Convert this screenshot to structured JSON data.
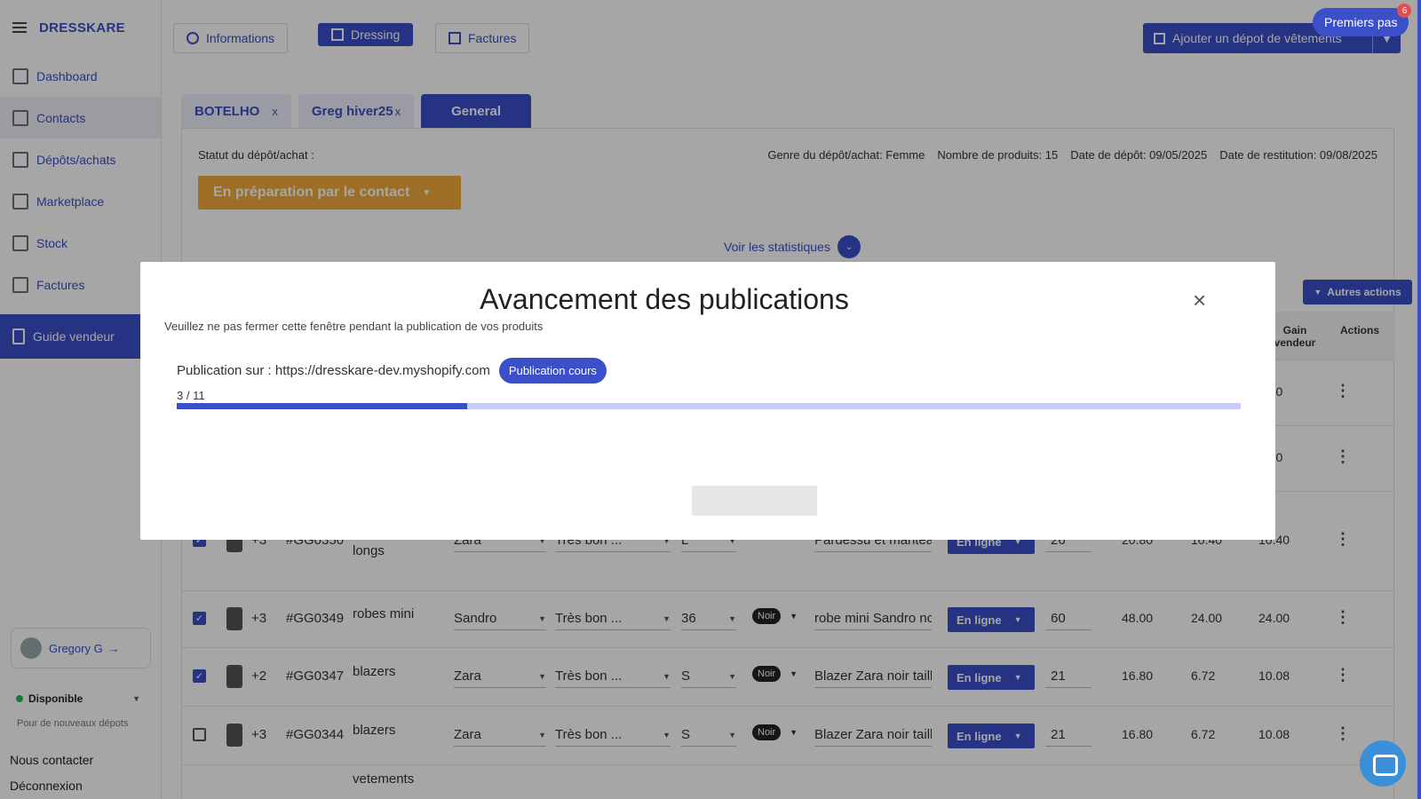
{
  "brand": "DRESSKARE",
  "nav": [
    "Dashboard",
    "Contacts",
    "Dépôts/achats",
    "Marketplace",
    "Stock",
    "Factures"
  ],
  "guide": "Guide vendeur",
  "user": "Gregory G",
  "dispo": "Disponible",
  "dispo_sub": "Pour de nouveaux dépots",
  "contact": "Nous contacter",
  "logout": "Déconnexion",
  "topbar": {
    "informations": "Informations",
    "dressing": "Dressing",
    "factures": "Factures",
    "add": "Ajouter un dépot de vêtements",
    "premiers": "Premiers pas",
    "badge": "6"
  },
  "tabs": [
    "BOTELHO",
    "Greg hiver25",
    "General"
  ],
  "tab_close": "x",
  "statut_label": "Statut du dépôt/achat :",
  "meta": {
    "genre": "Genre du dépôt/achat: Femme",
    "nb": "Nombre de produits: 15",
    "depot": "Date de dépôt: 09/05/2025",
    "restit": "Date de restitution: 09/08/2025"
  },
  "status_value": "En préparation par le contact",
  "voir": "Voir les statistiques",
  "autres": "Autres actions",
  "headers": {
    "gain": "Gain vendeur",
    "actions": "Actions"
  },
  "rows": [
    {
      "checked": false,
      "extra": "",
      "ref": "",
      "cat": "",
      "brand": "",
      "cond": "",
      "size": "",
      "color": "",
      "desc": "",
      "status": "",
      "qty": "",
      "p1": "",
      "p2": "",
      "p3": "7.20"
    },
    {
      "checked": false,
      "extra": "",
      "ref": "",
      "cat": "",
      "brand": "",
      "cond": "",
      "size": "",
      "color": "",
      "desc": "",
      "status": "",
      "qty": "",
      "p1": "",
      "p2": "",
      "p3": "7.20"
    },
    {
      "checked": true,
      "extra": "+3",
      "ref": "#GG0350",
      "cat": "manteaux longs",
      "brand": "Zara",
      "cond": "Très bon ...",
      "size": "L",
      "color": "",
      "desc": "Pardessu et mantea",
      "status": "En ligne",
      "qty": "26",
      "p1": "20.80",
      "p2": "10.40",
      "p3": "10.40"
    },
    {
      "checked": true,
      "extra": "+3",
      "ref": "#GG0349",
      "cat": "robes mini",
      "brand": "Sandro",
      "cond": "Très bon ...",
      "size": "36",
      "color": "Noir",
      "desc": "robe mini Sandro no",
      "status": "En ligne",
      "qty": "60",
      "p1": "48.00",
      "p2": "24.00",
      "p3": "24.00"
    },
    {
      "checked": true,
      "extra": "+2",
      "ref": "#GG0347",
      "cat": "blazers",
      "brand": "Zara",
      "cond": "Très bon ...",
      "size": "S",
      "color": "Noir",
      "desc": "Blazer Zara noir taill",
      "status": "En ligne",
      "qty": "21",
      "p1": "16.80",
      "p2": "6.72",
      "p3": "10.08"
    },
    {
      "checked": false,
      "extra": "+3",
      "ref": "#GG0344",
      "cat": "blazers",
      "brand": "Zara",
      "cond": "Très bon ...",
      "size": "S",
      "color": "Noir",
      "desc": "Blazer Zara noir taill",
      "status": "En ligne",
      "qty": "21",
      "p1": "16.80",
      "p2": "6.72",
      "p3": "10.08"
    },
    {
      "checked": false,
      "extra": "",
      "ref": "",
      "cat": "vetements",
      "brand": "",
      "cond": "",
      "size": "",
      "color": "",
      "desc": "",
      "status": "",
      "qty": "",
      "p1": "",
      "p2": "",
      "p3": ""
    }
  ],
  "modal": {
    "title": "Avancement des publications",
    "close": "×",
    "subtitle": "Veuillez ne pas fermer cette fenêtre pendant la publication de vos produits",
    "publication": "Publication sur : https://dresskare-dev.myshopify.com",
    "badge": "Publication cours",
    "count": "3 / 11",
    "progress": 0.2727
  }
}
